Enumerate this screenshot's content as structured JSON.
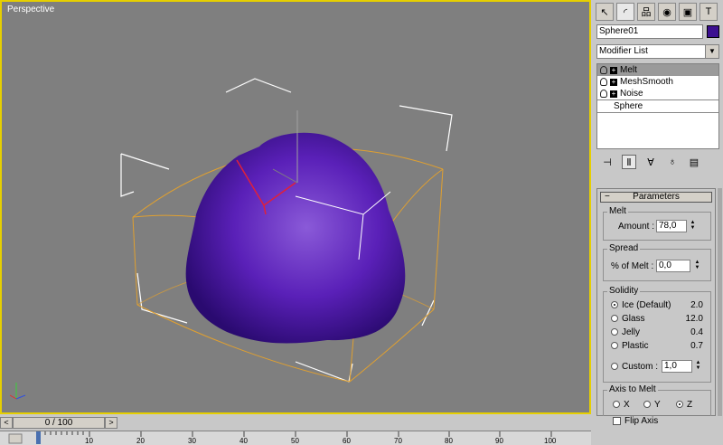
{
  "viewport": {
    "label": "Perspective"
  },
  "tripod": {
    "z": "z",
    "x": "x",
    "y": "y"
  },
  "timeline": {
    "prev": "<",
    "next": ">",
    "slider_label": "0 / 100",
    "ticks": [
      "10",
      "20",
      "30",
      "40",
      "50",
      "60",
      "70",
      "80",
      "90",
      "100"
    ]
  },
  "panel": {
    "tabs": [
      {
        "icon": "create-icon",
        "glyph": "↖"
      },
      {
        "icon": "modify-icon",
        "glyph": "◜"
      },
      {
        "icon": "hierarchy-icon",
        "glyph": "品"
      },
      {
        "icon": "motion-icon",
        "glyph": "◉"
      },
      {
        "icon": "display-icon",
        "glyph": "▣"
      },
      {
        "icon": "utilities-icon",
        "glyph": "T"
      }
    ],
    "object_name": "Sphere01",
    "object_color": "#3b0f90",
    "modifier_list": "Modifier List",
    "stack": [
      {
        "label": "Melt",
        "selected": true
      },
      {
        "label": "MeshSmooth",
        "selected": false
      },
      {
        "label": "Noise",
        "selected": false
      }
    ],
    "base_object": "Sphere",
    "rollout_title": "Parameters",
    "melt": {
      "group": "Melt",
      "amount_label": "Amount :",
      "amount_value": "78,0"
    },
    "spread": {
      "group": "Spread",
      "label": "% of Melt :",
      "value": "0,0"
    },
    "solidity": {
      "group": "Solidity",
      "options": [
        {
          "label": "Ice (Default)",
          "value": "2.0",
          "on": true
        },
        {
          "label": "Glass",
          "value": "12.0",
          "on": false
        },
        {
          "label": "Jelly",
          "value": "0.4",
          "on": false
        },
        {
          "label": "Plastic",
          "value": "0.7",
          "on": false
        }
      ],
      "custom_label": "Custom :",
      "custom_value": "1,0"
    },
    "axis": {
      "group": "Axis to Melt",
      "x": "X",
      "y": "Y",
      "z": "Z",
      "selected": "Z",
      "flip_label": "Flip Axis"
    }
  }
}
